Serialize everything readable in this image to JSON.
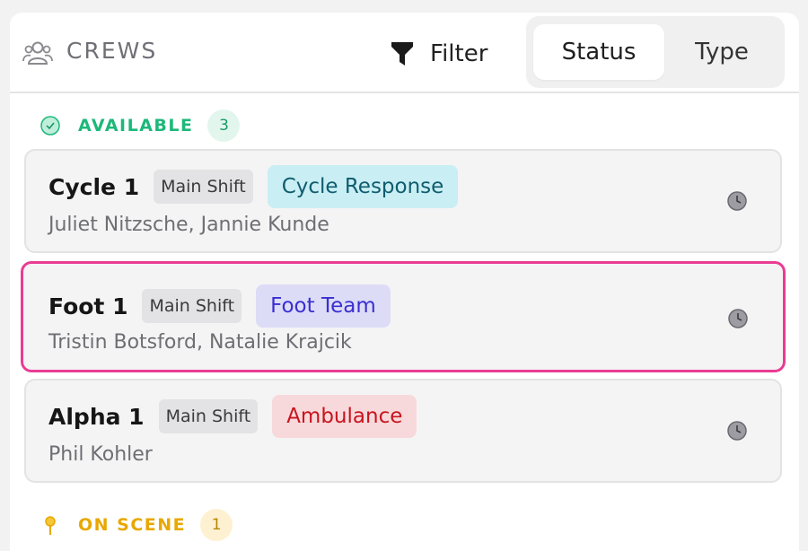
{
  "header": {
    "title": "CREWS",
    "filter_label": "Filter",
    "tabs": [
      {
        "label": "Status",
        "active": true
      },
      {
        "label": "Type",
        "active": false
      }
    ]
  },
  "sections": [
    {
      "label": "AVAILABLE",
      "count": "3",
      "color": "#1db87a",
      "crews": [
        {
          "name": "Cycle 1",
          "shift": "Main Shift",
          "type": "Cycle Response",
          "type_bg": "#c9eef4",
          "type_fg": "#0f5d6e",
          "members": "Juliet Nitzsche, Jannie Kunde",
          "selected": false
        },
        {
          "name": "Foot 1",
          "shift": "Main Shift",
          "type": "Foot Team",
          "type_bg": "#dcdcf7",
          "type_fg": "#3a2ed0",
          "members": "Tristin Botsford, Natalie Krajcik",
          "selected": true
        },
        {
          "name": "Alpha 1",
          "shift": "Main Shift",
          "type": "Ambulance",
          "type_bg": "#f7d9db",
          "type_fg": "#c8141e",
          "members": "Phil Kohler",
          "selected": false
        }
      ]
    },
    {
      "label": "ON SCENE",
      "count": "1",
      "color": "#e8a800",
      "crews": []
    }
  ],
  "colors": {
    "selected_border": "#ea3c93",
    "available": "#1db87a",
    "on_scene": "#e8a800"
  }
}
